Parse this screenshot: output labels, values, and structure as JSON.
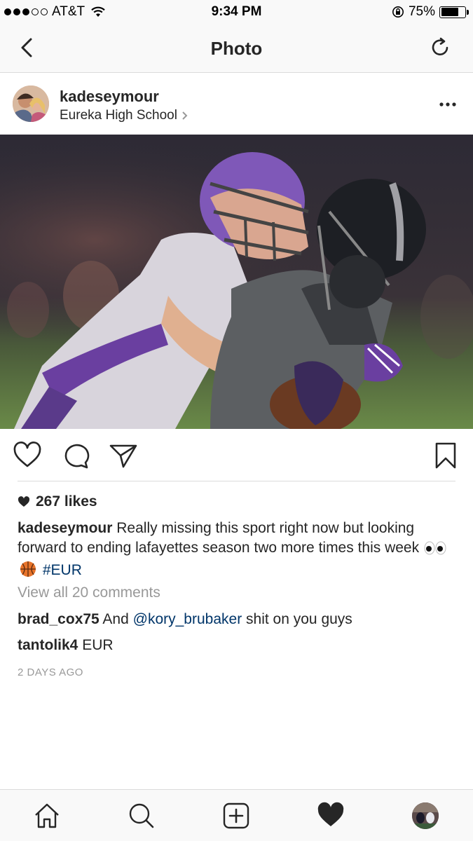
{
  "status_bar": {
    "carrier": "AT&T",
    "time": "9:34 PM",
    "battery": "75%",
    "battery_level": 0.75
  },
  "nav": {
    "title": "Photo",
    "back_icon": "chevron-left-icon",
    "refresh_icon": "refresh-icon"
  },
  "post": {
    "username": "kadeseymour",
    "location": "Eureka High School",
    "likes": "267 likes",
    "caption_user": "kadeseymour",
    "caption_text": "Really missing this sport right now but looking forward to ending lafayettes season two more times this week",
    "caption_hashtag": "#EUR",
    "view_all": "View all 20 comments",
    "comments": [
      {
        "user": "brad_cox75",
        "prefix": "And",
        "mention": "@kory_brubaker",
        "suffix": "shit on you guys"
      },
      {
        "user": "tantolik4",
        "text": "EUR"
      }
    ],
    "timestamp": "2 DAYS AGO"
  },
  "colors": {
    "link": "#003569",
    "muted": "#999999",
    "text": "#262626",
    "bar_bg": "#f9f9f9"
  }
}
